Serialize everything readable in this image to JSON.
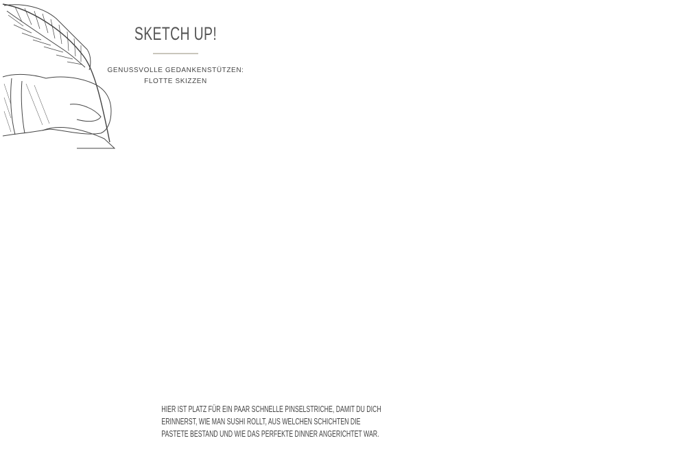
{
  "header": {
    "title": "SKETCH UP!",
    "subtitle_line1": "GENUSSVOLLE GEDANKENSTÜTZEN:",
    "subtitle_line2": "FLOTTE SKIZZEN"
  },
  "footer": {
    "lines": [
      "HIER IST PLATZ FÜR EIN PAAR SCHNELLE PINSELSTRICHE, DAMIT DU DICH",
      "ERINNERST, WIE MAN SUSHI ROLLT, AUS WELCHEN SCHICHTEN DIE",
      "PASTETE BESTAND UND WIE DAS PERFEKTE DINNER ANGERICHTET WAR."
    ]
  },
  "colors": {
    "text": "#555555",
    "rule": "#c9c6bc"
  },
  "icons": {
    "illustration": "hand-with-quill-icon"
  }
}
